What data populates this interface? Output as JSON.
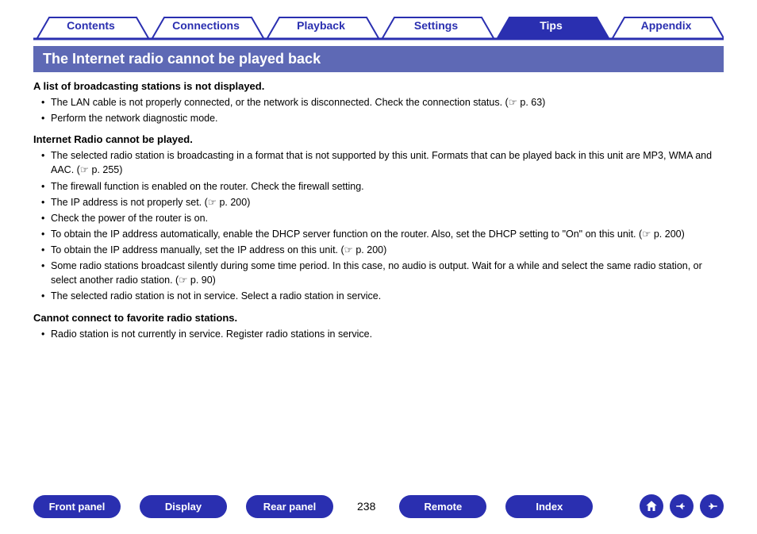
{
  "tabs": [
    "Contents",
    "Connections",
    "Playback",
    "Settings",
    "Tips",
    "Appendix"
  ],
  "activeTabIndex": 4,
  "sectionTitle": "The Internet radio cannot be played back",
  "groups": [
    {
      "heading": "A list of broadcasting stations is not displayed.",
      "items": [
        "The LAN cable is not properly connected, or the network is disconnected. Check the connection status.  (☞ p. 63)",
        "Perform the network diagnostic mode."
      ]
    },
    {
      "heading": "Internet Radio cannot be played.",
      "items": [
        "The selected radio station is broadcasting in a format that is not supported by this unit. Formats that can be played back in this unit are MP3, WMA and AAC.  (☞ p. 255)",
        "The firewall function is enabled on the router. Check the firewall setting.",
        "The IP address is not properly set.  (☞ p. 200)",
        "Check the power of the router is on.",
        "To obtain the IP address automatically, enable the DHCP server function on the router. Also, set the DHCP setting to \"On\" on this unit.  (☞ p. 200)",
        "To obtain the IP address manually, set the IP address on this unit.  (☞ p. 200)",
        "Some radio stations broadcast silently during some time period. In this case, no audio is output. Wait for a while and select the same radio station, or select another radio station.  (☞ p. 90)",
        "The selected radio station is not in service. Select a radio station in service."
      ]
    },
    {
      "heading": "Cannot connect to favorite radio stations.",
      "items": [
        "Radio station is not currently in service. Register radio stations in service."
      ]
    }
  ],
  "footer": {
    "buttons": [
      "Front panel",
      "Display",
      "Rear panel",
      "Remote",
      "Index"
    ],
    "pageNumber": "238",
    "icons": [
      "home-icon",
      "prev-icon",
      "next-icon"
    ]
  },
  "colors": {
    "accent": "#2a2fb0",
    "sectionBg": "#5e69b5"
  }
}
